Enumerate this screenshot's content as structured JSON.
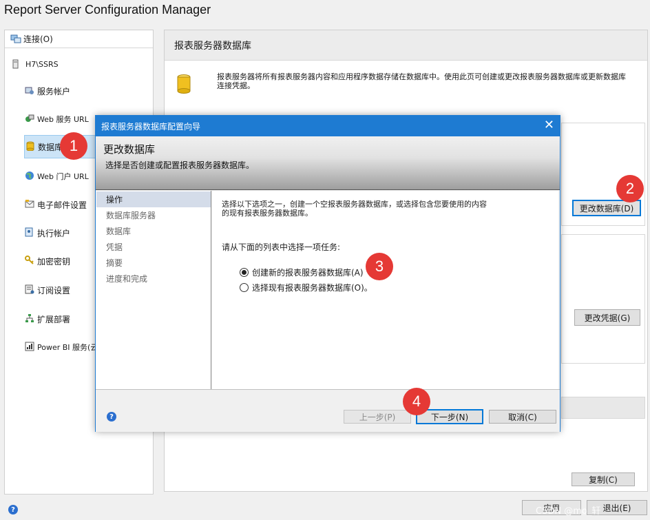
{
  "window": {
    "title": "Report Server Configuration Manager"
  },
  "nav": {
    "connect_label": "连接(O)",
    "server": "H7\\SSRS",
    "items": [
      {
        "label": "服务帐户",
        "icon": "service-account-icon"
      },
      {
        "label": "Web 服务 URL",
        "icon": "web-service-icon"
      },
      {
        "label": "数据库",
        "icon": "database-icon",
        "selected": true
      },
      {
        "label": "Web 门户 URL",
        "icon": "globe-icon"
      },
      {
        "label": "电子邮件设置",
        "icon": "email-icon"
      },
      {
        "label": "执行帐户",
        "icon": "execution-account-icon"
      },
      {
        "label": "加密密钥",
        "icon": "key-icon"
      },
      {
        "label": "订阅设置",
        "icon": "subscription-icon"
      },
      {
        "label": "扩展部署",
        "icon": "scale-out-icon"
      },
      {
        "label": "Power BI 服务(云",
        "icon": "power-bi-icon"
      }
    ]
  },
  "main": {
    "header": "报表服务器数据库",
    "description": "报表服务器将所有报表服务器内容和应用程序数据存储在数据库中。使用此页可创建或更改报表服务器数据库或更新数据库连接凭据。",
    "change_db_button": "更改数据库(D)",
    "change_cred_button": "更改凭据(G)",
    "copy_button": "复制(C)",
    "exit_button": "退出(E)",
    "apply_button": "应用"
  },
  "dialog": {
    "title": "报表服务器数据库配置向导",
    "heading": "更改数据库",
    "subheading": "选择是否创建或配置报表服务器数据库。",
    "steps": [
      "操作",
      "数据库服务器",
      "数据库",
      "凭据",
      "摘要",
      "进度和完成"
    ],
    "active_step": "操作",
    "intro_line1": "选择以下选项之一，创建一个空报表服务器数据库，或选择包含您要使用的内容",
    "intro_line2": "的现有报表服务器数据库。",
    "prompt": "请从下面的列表中选择一项任务:",
    "options": [
      {
        "label": "创建新的报表服务器数据库(A)",
        "selected": true
      },
      {
        "label": "选择现有报表服务器数据库(O)。",
        "selected": false
      }
    ],
    "back_button": "上一步(P)",
    "next_button": "下一步(N)",
    "cancel_button": "取消(C)"
  },
  "markers": [
    "1",
    "2",
    "3",
    "4"
  ],
  "watermark": "CSDN @mo_轩",
  "colors": {
    "titlebar": "#1e7bd2",
    "selection": "#cce4f7",
    "marker": "#e53935"
  }
}
